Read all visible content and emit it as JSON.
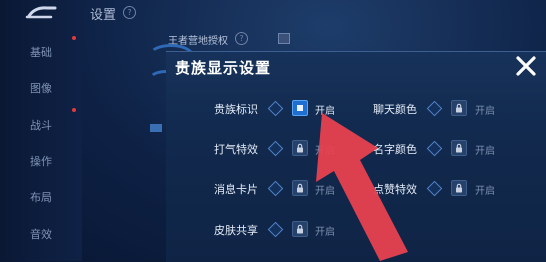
{
  "page": {
    "title": "设置"
  },
  "sidebar": {
    "items": [
      {
        "label": "基础"
      },
      {
        "label": "图像"
      },
      {
        "label": "战斗"
      },
      {
        "label": "操作"
      },
      {
        "label": "布局"
      },
      {
        "label": "音效"
      }
    ]
  },
  "behind": {
    "auth_label": "王者营地授权"
  },
  "dialog": {
    "title": "贵族显示设置",
    "settings": [
      {
        "label": "贵族标识",
        "state": "开启",
        "checked": true,
        "locked": false
      },
      {
        "label": "聊天颜色",
        "state": "开启",
        "checked": false,
        "locked": true
      },
      {
        "label": "打气特效",
        "state": "开启",
        "checked": false,
        "locked": true
      },
      {
        "label": "名字颜色",
        "state": "开启",
        "checked": false,
        "locked": true
      },
      {
        "label": "消息卡片",
        "state": "开启",
        "checked": false,
        "locked": true
      },
      {
        "label": "点赞特效",
        "state": "开启",
        "checked": false,
        "locked": true
      },
      {
        "label": "皮肤共享",
        "state": "开启",
        "checked": false,
        "locked": true
      }
    ]
  },
  "colors": {
    "accent": "#1f6fd0",
    "arrow": "#e8414f",
    "background": "#0e2145"
  }
}
